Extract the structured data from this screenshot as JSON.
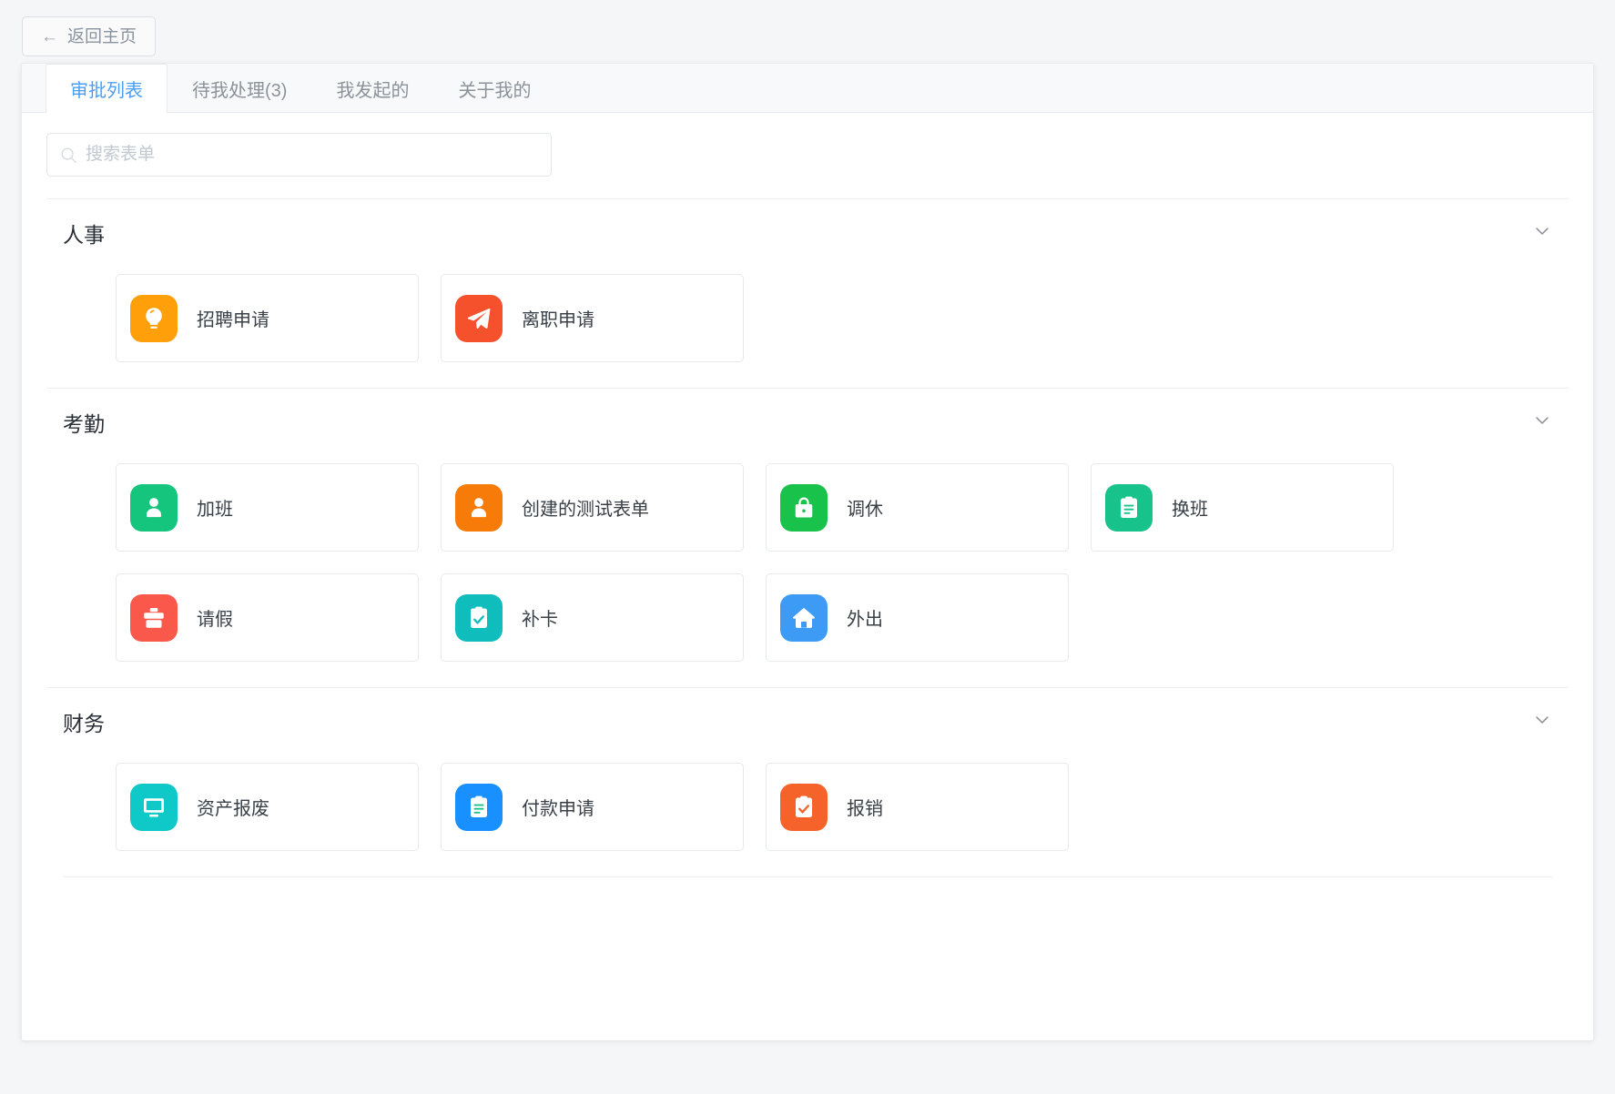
{
  "back_button": {
    "label": "返回主页",
    "icon": "arrow-left-icon"
  },
  "tabs": [
    {
      "label": "审批列表",
      "active": true
    },
    {
      "label": "待我处理(3)",
      "active": false
    },
    {
      "label": "我发起的",
      "active": false
    },
    {
      "label": "关于我的",
      "active": false
    }
  ],
  "search": {
    "placeholder": "搜索表单",
    "value": "",
    "icon": "search-icon"
  },
  "colors": {
    "active_tab": "#4a9ff5",
    "text_primary": "#2b3038",
    "text_secondary": "#8c9299",
    "border": "#e6e9ed"
  },
  "sections": [
    {
      "title": "人事",
      "collapse_icon": "chevron-down-icon",
      "items": [
        {
          "label": "招聘申请",
          "icon": "lightbulb-icon",
          "color": "#FFA00A"
        },
        {
          "label": "离职申请",
          "icon": "paper-plane-icon",
          "color": "#F5512C"
        }
      ]
    },
    {
      "title": "考勤",
      "collapse_icon": "chevron-down-icon",
      "items": [
        {
          "label": "加班",
          "icon": "person-icon",
          "color": "#15C57E"
        },
        {
          "label": "创建的测试表单",
          "icon": "person-icon",
          "color": "#F77B09"
        },
        {
          "label": "调休",
          "icon": "bag-icon",
          "color": "#18C24B"
        },
        {
          "label": "换班",
          "icon": "clipboard-icon",
          "color": "#17C38A"
        },
        {
          "label": "请假",
          "icon": "briefcase-icon",
          "color": "#F9584A"
        },
        {
          "label": "补卡",
          "icon": "clipboard-check-icon",
          "color": "#0FBDBD"
        },
        {
          "label": "外出",
          "icon": "home-icon",
          "color": "#3D9BF5"
        }
      ]
    },
    {
      "title": "财务",
      "collapse_icon": "chevron-down-icon",
      "items": [
        {
          "label": "资产报废",
          "icon": "monitor-icon",
          "color": "#0FC9C9"
        },
        {
          "label": "付款申请",
          "icon": "clipboard-icon",
          "color": "#1890FF"
        },
        {
          "label": "报销",
          "icon": "clipboard-check-icon",
          "color": "#F5632A"
        }
      ]
    }
  ]
}
